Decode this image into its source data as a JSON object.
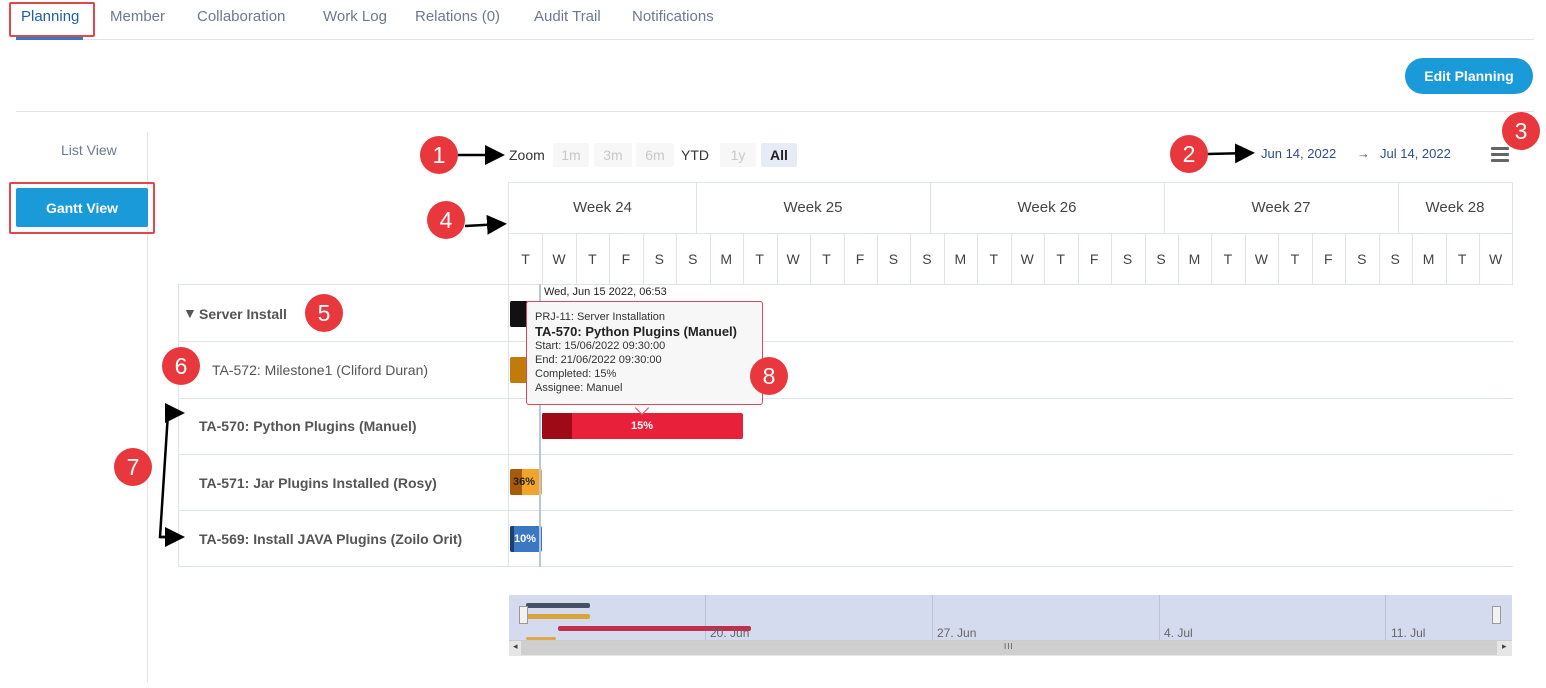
{
  "tabs": [
    {
      "label": "Planning",
      "active": true
    },
    {
      "label": "Member"
    },
    {
      "label": "Collaboration"
    },
    {
      "label": "Work Log"
    },
    {
      "label": "Relations (0)"
    },
    {
      "label": "Audit Trail"
    },
    {
      "label": "Notifications"
    }
  ],
  "edit_planning_label": "Edit Planning",
  "view_switch": {
    "list_view": "List View",
    "gantt_view": "Gantt View"
  },
  "zoom": {
    "label": "Zoom",
    "options": [
      {
        "label": "1m",
        "state": "disabled"
      },
      {
        "label": "3m",
        "state": "disabled"
      },
      {
        "label": "6m",
        "state": "disabled"
      },
      {
        "label": "YTD",
        "state": "normal"
      },
      {
        "label": "1y",
        "state": "disabled"
      },
      {
        "label": "All",
        "state": "selected"
      }
    ]
  },
  "range": {
    "from": "Jun 14, 2022",
    "arrow": "→",
    "to": "Jul 14, 2022"
  },
  "markers": [
    "1",
    "2",
    "3",
    "4",
    "5",
    "6",
    "7",
    "8"
  ],
  "weeks": [
    "Week 24",
    "Week 25",
    "Week 26",
    "Week 27",
    "Week 28"
  ],
  "days": [
    "T",
    "W",
    "T",
    "F",
    "S",
    "S",
    "M",
    "T",
    "W",
    "T",
    "F",
    "S",
    "S",
    "M",
    "T",
    "W",
    "T",
    "F",
    "S",
    "S",
    "M",
    "T",
    "W",
    "T",
    "F",
    "S",
    "S",
    "M",
    "T",
    "W"
  ],
  "rows": [
    {
      "label": "Server Install",
      "type": "group",
      "expand_glyph": "▼"
    },
    {
      "label": "TA-572: Milestone1 (Cliford Duran)",
      "type": "milestone"
    },
    {
      "label": "TA-570: Python Plugins (Manuel)",
      "type": "task"
    },
    {
      "label": "TA-571: Jar Plugins Installed (Rosy)",
      "type": "task"
    },
    {
      "label": "TA-569: Install JAVA Plugins (Zoilo Orit)",
      "type": "task"
    }
  ],
  "bars": [
    {
      "row": "Server Install",
      "color": "#111111",
      "completed": null,
      "label": ""
    },
    {
      "row": "TA-572",
      "color": "#c27b0a",
      "completed": null,
      "label": ""
    },
    {
      "row": "TA-570",
      "color": "#e8203a",
      "completed_color": "#9e0a16",
      "completed": 15,
      "label": "15%"
    },
    {
      "row": "TA-571",
      "color": "#f2a42a",
      "completed_color": "#a85a0a",
      "completed": 36,
      "label": "36%"
    },
    {
      "row": "TA-569",
      "color": "#3a78c2",
      "completed_color": "#1d3f73",
      "completed": 10,
      "label": "10%"
    }
  ],
  "today_label": "Wed, Jun 15 2022, 06:53",
  "tooltip": {
    "project": "PRJ-11: Server Installation",
    "title": "TA-570: Python Plugins (Manuel)",
    "start": "Start: 15/06/2022 09:30:00",
    "end": "End: 21/06/2022 09:30:00",
    "completed": "Completed: 15%",
    "assignee": "Assignee: Manuel"
  },
  "navigator": {
    "labels": [
      "20. Jun",
      "27. Jun",
      "4. Jul",
      "11. Jul"
    ],
    "scroll_left": "◂",
    "scroll_right": "▸",
    "thumb_grip": "III"
  },
  "colors": {
    "accent": "#1a9ad9",
    "marker": "#e8383d",
    "link": "#2d4e8c"
  }
}
